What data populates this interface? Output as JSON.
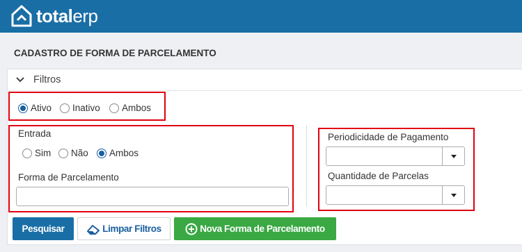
{
  "app": {
    "logo_bold": "total",
    "logo_light": "erp"
  },
  "page": {
    "title": "CADASTRO DE FORMA DE PARCELAMENTO"
  },
  "filters": {
    "title": "Filtros",
    "status": {
      "options": [
        "Ativo",
        "Inativo",
        "Ambos"
      ],
      "selected": "Ativo"
    },
    "entrada": {
      "label": "Entrada",
      "options": [
        "Sim",
        "Não",
        "Ambos"
      ],
      "selected": "Ambos"
    },
    "forma_parcelamento": {
      "label": "Forma de Parcelamento",
      "value": ""
    },
    "periodicidade": {
      "label": "Periodicidade de Pagamento",
      "value": ""
    },
    "quantidade": {
      "label": "Quantidade de Parcelas",
      "value": ""
    }
  },
  "actions": {
    "search": "Pesquisar",
    "clear": "Limpar Filtros",
    "new": "Nova Forma de Parcelamento"
  },
  "icons": {
    "collapse": "chevron-down-icon",
    "eraser": "eraser-icon",
    "add": "plus-circle-icon",
    "logo": "house-logo-icon"
  },
  "colors": {
    "brand": "#1a6ea6",
    "success": "#3aa843",
    "highlight": "#e0000f"
  }
}
